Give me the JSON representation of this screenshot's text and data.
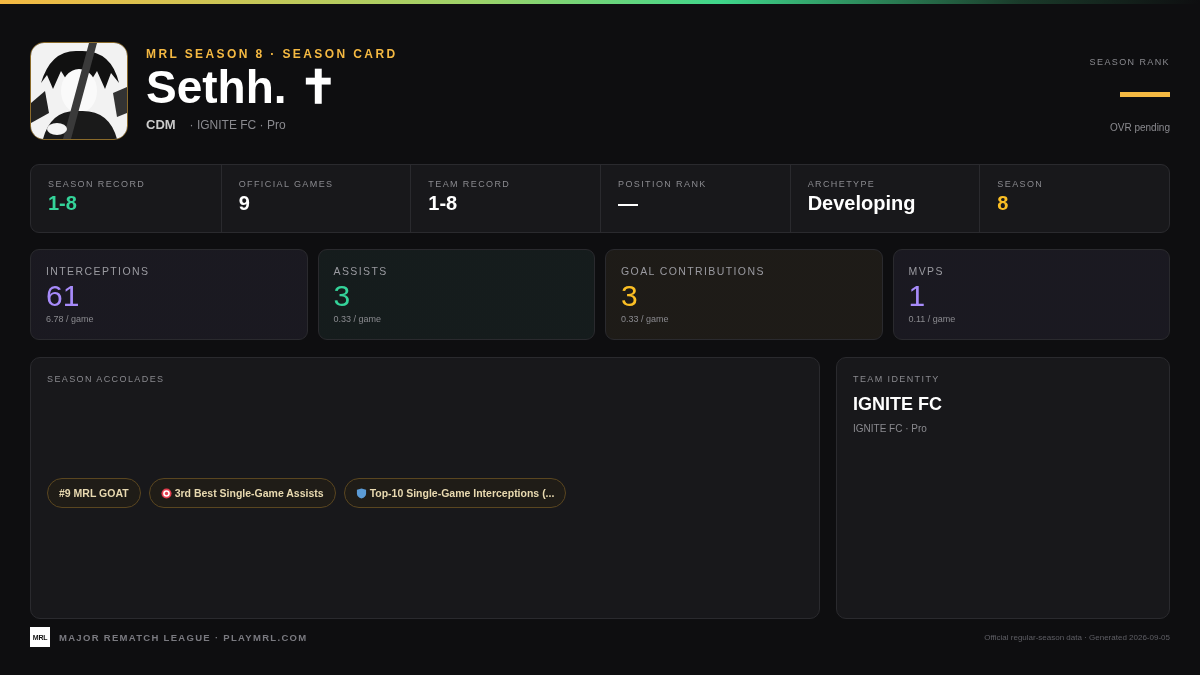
{
  "header": {
    "eyebrow": "MRL SEASON 8 · SEASON CARD",
    "player_name": "Sethh. ✝",
    "position": "CDM",
    "team_line": "· IGNITE FC · Pro"
  },
  "season_rank": {
    "label": "SEASON RANK",
    "note": "OVR pending"
  },
  "summary": [
    {
      "label": "SEASON RECORD",
      "value": "1-8",
      "color": "#34d399"
    },
    {
      "label": "OFFICIAL GAMES",
      "value": "9",
      "color": "#ffffff"
    },
    {
      "label": "TEAM RECORD",
      "value": "1-8",
      "color": "#ffffff"
    },
    {
      "label": "POSITION RANK",
      "value": "—",
      "color": "#ffffff"
    },
    {
      "label": "ARCHETYPE",
      "value": "Developing",
      "color": "#ffffff"
    },
    {
      "label": "SEASON",
      "value": "8",
      "color": "#fbbf24"
    }
  ],
  "stat_cards": [
    {
      "label": "INTERCEPTIONS",
      "value": "61",
      "per_game": "6.78 / game",
      "color": "#a78bfa"
    },
    {
      "label": "ASSISTS",
      "value": "3",
      "per_game": "0.33 / game",
      "color": "#34d399"
    },
    {
      "label": "GOAL CONTRIBUTIONS",
      "value": "3",
      "per_game": "0.33 / game",
      "color": "#fbbf24"
    },
    {
      "label": "MVPS",
      "value": "1",
      "per_game": "0.11 / game",
      "color": "#a78bfa"
    }
  ],
  "accolades": {
    "title": "SEASON ACCOLADES",
    "items": [
      {
        "kind": "plain",
        "text": "#9 MRL GOAT"
      },
      {
        "kind": "target",
        "text": "3rd Best Single-Game Assists"
      },
      {
        "kind": "shield",
        "text": "Top-10 Single-Game Interceptions (..."
      }
    ]
  },
  "team_identity": {
    "title": "TEAM IDENTITY",
    "name": "IGNITE FC",
    "subtitle": "IGNITE FC · Pro"
  },
  "footer": {
    "logo_text": "MRL",
    "league": "MAJOR REMATCH LEAGUE · PLAYMRL.COM",
    "note": "Official regular-season data · Generated 2026-09-05"
  }
}
